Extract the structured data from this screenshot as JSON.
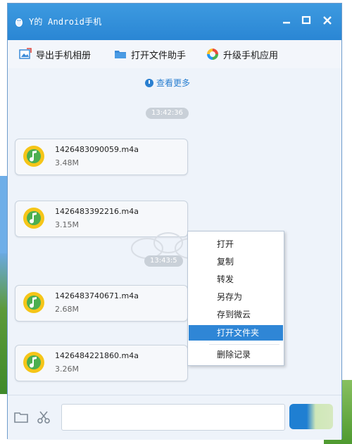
{
  "window": {
    "title": "Y的 Android手机"
  },
  "toolbar": {
    "items": [
      {
        "label": "导出手机相册",
        "icon": "photo-export-icon"
      },
      {
        "label": "打开文件助手",
        "icon": "folder-icon"
      },
      {
        "label": "升级手机应用",
        "icon": "app-upgrade-icon"
      }
    ]
  },
  "chat": {
    "view_more": "查看更多",
    "timestamps": [
      "13:42:36",
      "13:43:5"
    ],
    "messages": [
      {
        "filename": "1426483090059.m4a",
        "size": "3.48M"
      },
      {
        "filename": "1426483392216.m4a",
        "size": "3.15M"
      },
      {
        "filename": "1426483740671.m4a",
        "size": "2.68M"
      },
      {
        "filename": "1426484221860.m4a",
        "size": "3.26M"
      }
    ]
  },
  "context_menu": {
    "items": [
      "打开",
      "复制",
      "转发",
      "另存为",
      "存到微云",
      "打开文件夹",
      "删除记录"
    ],
    "selected": "打开文件夹"
  },
  "colors": {
    "title_blue": "#2a86d4",
    "selection_blue": "#2f86d6",
    "link_blue": "#2a7fd0"
  }
}
